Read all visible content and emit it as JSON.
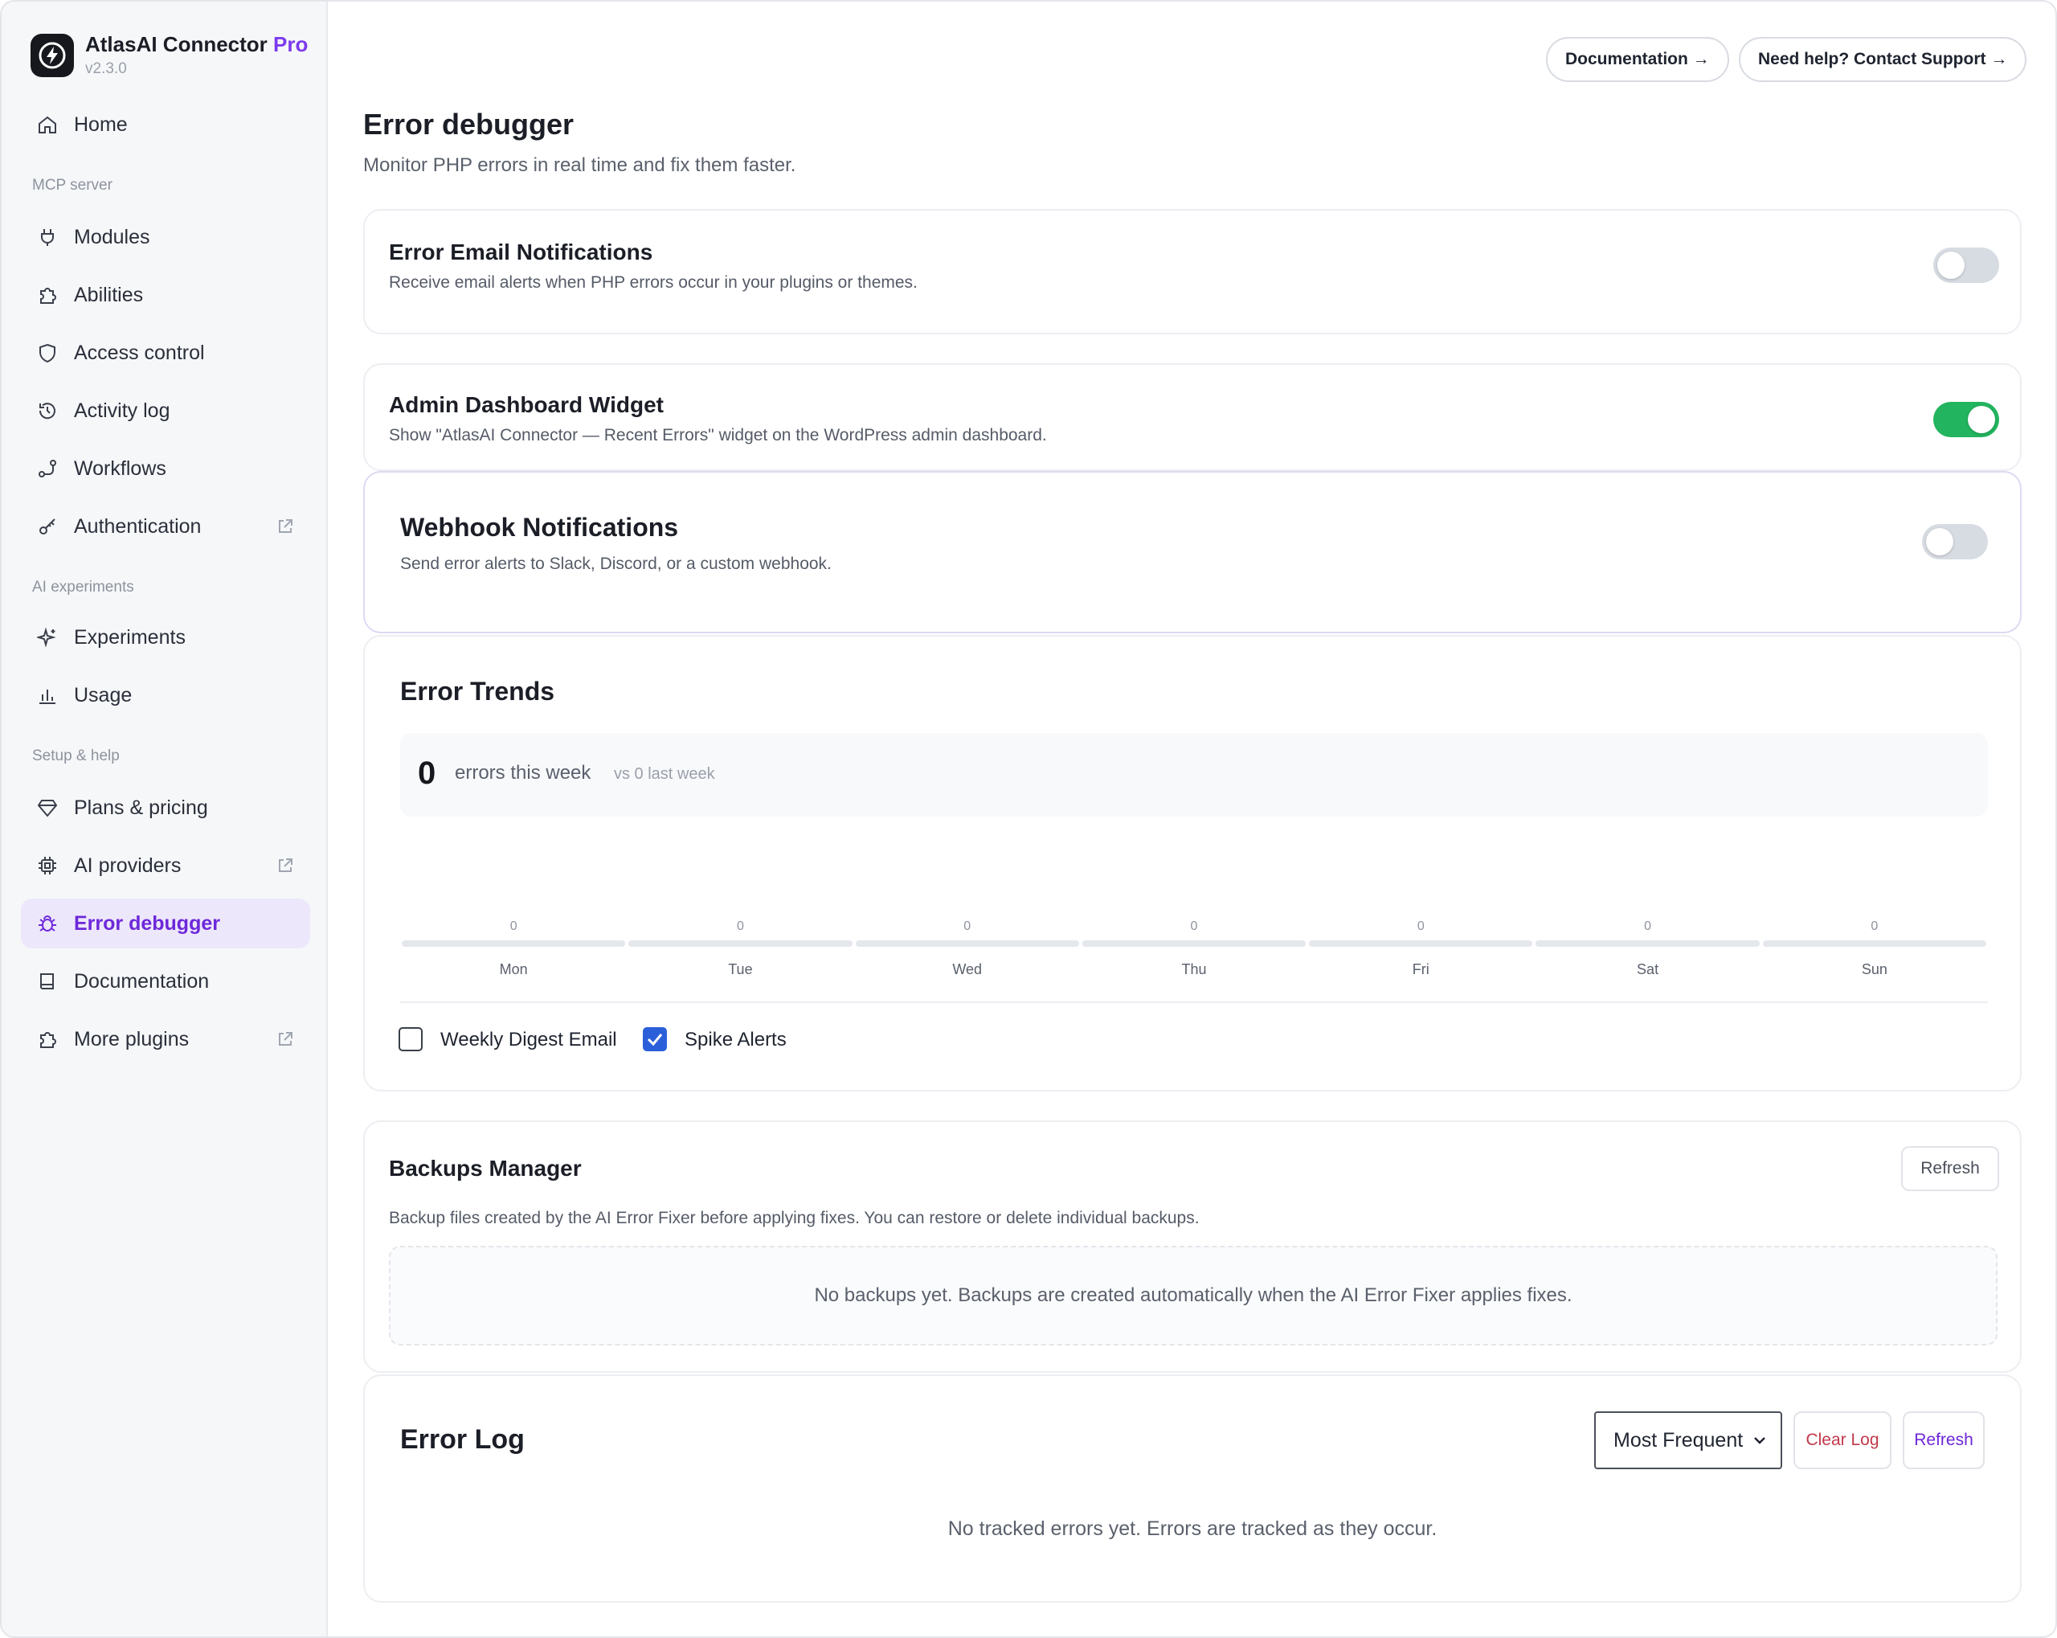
{
  "brand": {
    "name": "AtlasAI Connector",
    "tier": "Pro",
    "version": "v2.3.0"
  },
  "sidebar": {
    "home": "Home",
    "section_mcp": "MCP server",
    "modules": "Modules",
    "abilities": "Abilities",
    "access_control": "Access control",
    "activity_log": "Activity log",
    "workflows": "Workflows",
    "authentication": "Authentication",
    "section_ai": "AI experiments",
    "experiments": "Experiments",
    "usage": "Usage",
    "section_setup": "Setup & help",
    "plans": "Plans & pricing",
    "ai_providers": "AI providers",
    "error_debugger": "Error debugger",
    "documentation": "Documentation",
    "more_plugins": "More plugins"
  },
  "header": {
    "documentation_btn": "Documentation →",
    "support_btn": "Need help? Contact Support →"
  },
  "page": {
    "title": "Error debugger",
    "subtitle": "Monitor PHP errors in real time and fix them faster."
  },
  "email_notifications": {
    "title": "Error Email Notifications",
    "desc": "Receive email alerts when PHP errors occur in your plugins or themes.",
    "enabled": false
  },
  "dashboard_widget": {
    "title": "Admin Dashboard Widget",
    "desc": "Show \"AtlasAI Connector — Recent Errors\" widget on the WordPress admin dashboard.",
    "enabled": true
  },
  "webhook": {
    "title": "Webhook Notifications",
    "desc": "Send error alerts to Slack, Discord, or a custom webhook.",
    "enabled": false
  },
  "trends": {
    "title": "Error Trends",
    "count": "0",
    "count_label": "errors this week",
    "vs_label": "vs 0 last week",
    "days": [
      {
        "label": "Mon",
        "value": "0"
      },
      {
        "label": "Tue",
        "value": "0"
      },
      {
        "label": "Wed",
        "value": "0"
      },
      {
        "label": "Thu",
        "value": "0"
      },
      {
        "label": "Fri",
        "value": "0"
      },
      {
        "label": "Sat",
        "value": "0"
      },
      {
        "label": "Sun",
        "value": "0"
      }
    ],
    "weekly_digest": "Weekly Digest Email",
    "weekly_digest_checked": false,
    "spike_alerts": "Spike Alerts",
    "spike_alerts_checked": true
  },
  "backups": {
    "title": "Backups Manager",
    "refresh": "Refresh",
    "desc": "Backup files created by the AI Error Fixer before applying fixes. You can restore or delete individual backups.",
    "empty": "No backups yet. Backups are created automatically when the AI Error Fixer applies fixes."
  },
  "error_log": {
    "title": "Error Log",
    "sort_value": "Most Frequent",
    "clear": "Clear Log",
    "refresh": "Refresh",
    "empty": "No tracked errors yet. Errors are tracked as they occur."
  },
  "colors": {
    "accent": "#6d28d9",
    "toggle_on": "#22b45e",
    "toggle_off": "#d7dbe2",
    "checkbox_checked": "#2b5fd9",
    "danger": "#c0394b"
  }
}
